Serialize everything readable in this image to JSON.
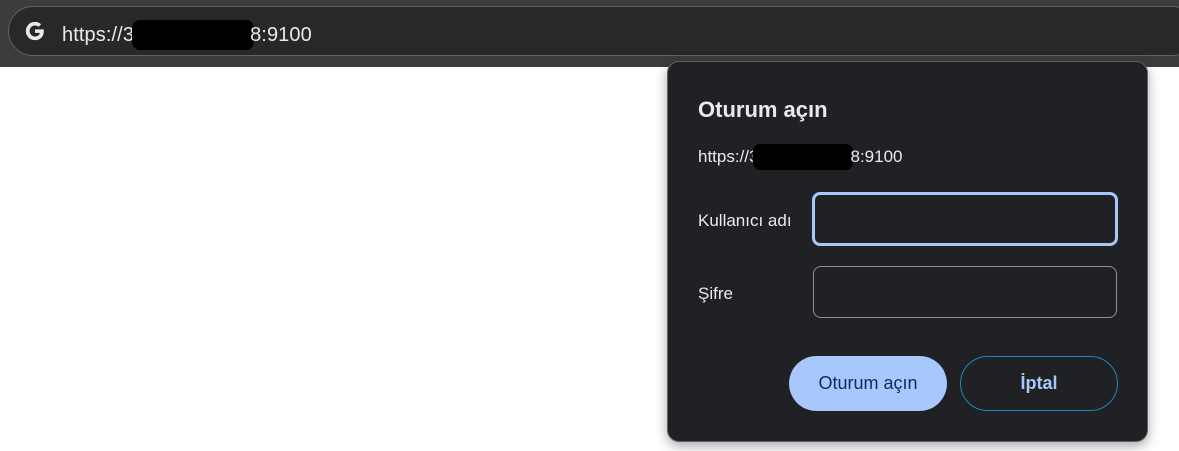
{
  "browser": {
    "address_bar": {
      "url_prefix": "https://",
      "url_redacted_fragment": "3",
      "url_suffix": "8:9100",
      "icon": "google-g-icon"
    }
  },
  "auth_dialog": {
    "title": "Oturum açın",
    "origin_prefix": "https://",
    "origin_redacted_fragment": "3",
    "origin_suffix": "8:9100",
    "username_label": "Kullanıcı adı",
    "username_value": "",
    "password_label": "Şifre",
    "password_value": "",
    "sign_in_button": "Oturum açın",
    "cancel_button": "İptal"
  },
  "colors": {
    "toolbar_bg": "#3c3c3c",
    "dialog_bg": "#202124",
    "accent": "#a8c7fa",
    "primary_text_on_accent": "#062e6f",
    "cancel_border": "#1f86b8"
  }
}
